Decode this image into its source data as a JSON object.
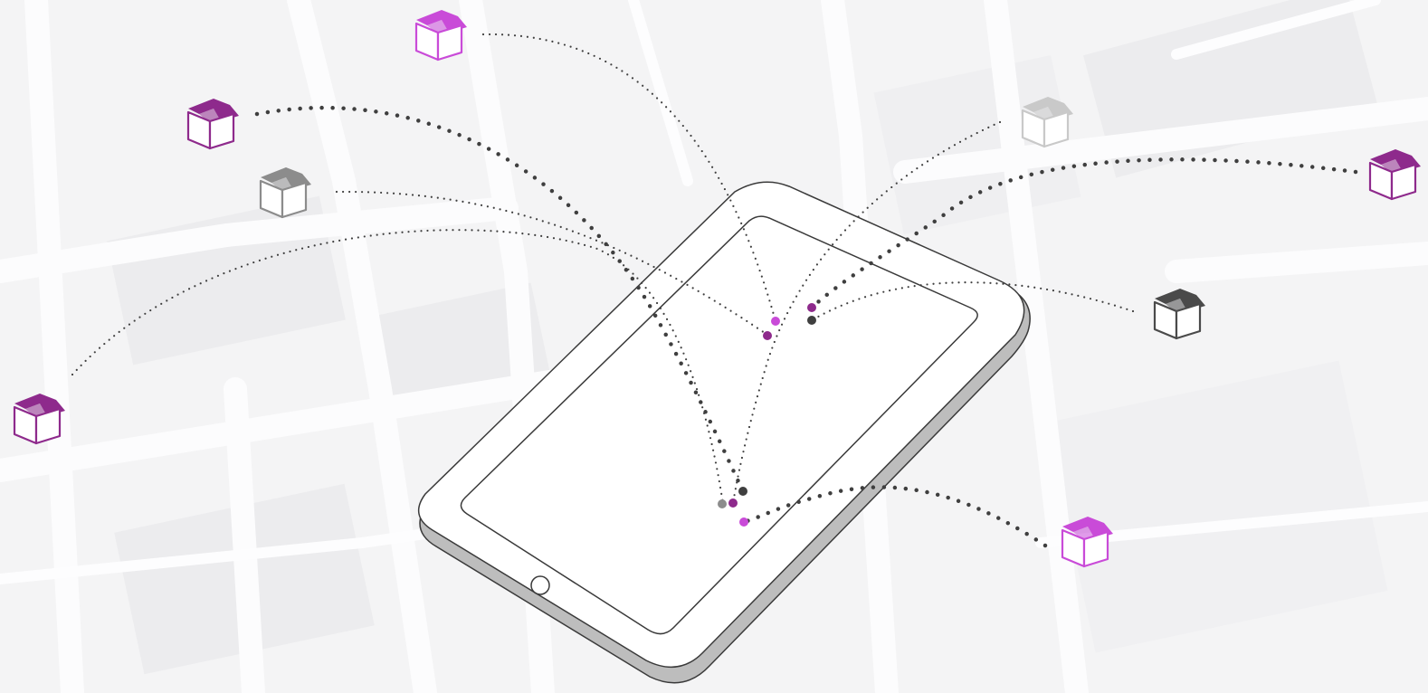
{
  "colors": {
    "background": "#f4f4f5",
    "map_streets": "#fbfbfc",
    "map_blocks": "#eeeef0",
    "device_outline": "#3a3a3a",
    "device_edge": "#bdbdbd",
    "screen": "#ffffff",
    "line": "#3f3f3f",
    "box_dark_purple": "#8e2a8c",
    "box_bright_purple": "#c94bd8",
    "box_mid_gray": "#8c8c8c",
    "box_light_gray": "#c9c9c9",
    "box_charcoal": "#4a4a4a"
  },
  "device": {
    "type": "tablet",
    "home_button": true
  },
  "packages": [
    {
      "id": "pkg-top-center",
      "icon": "open-box-icon",
      "color": "#c94bd8"
    },
    {
      "id": "pkg-upper-left",
      "icon": "open-box-icon",
      "color": "#8e2a8c"
    },
    {
      "id": "pkg-left-gray",
      "icon": "open-box-icon",
      "color": "#8c8c8c"
    },
    {
      "id": "pkg-far-left",
      "icon": "open-box-icon",
      "color": "#8e2a8c"
    },
    {
      "id": "pkg-upper-right-gray",
      "icon": "open-box-icon",
      "color": "#c9c9c9"
    },
    {
      "id": "pkg-far-right",
      "icon": "open-box-icon",
      "color": "#8e2a8c"
    },
    {
      "id": "pkg-right-dark",
      "icon": "open-box-icon",
      "color": "#4a4a4a"
    },
    {
      "id": "pkg-lower-right",
      "icon": "open-box-icon",
      "color": "#c94bd8"
    }
  ]
}
